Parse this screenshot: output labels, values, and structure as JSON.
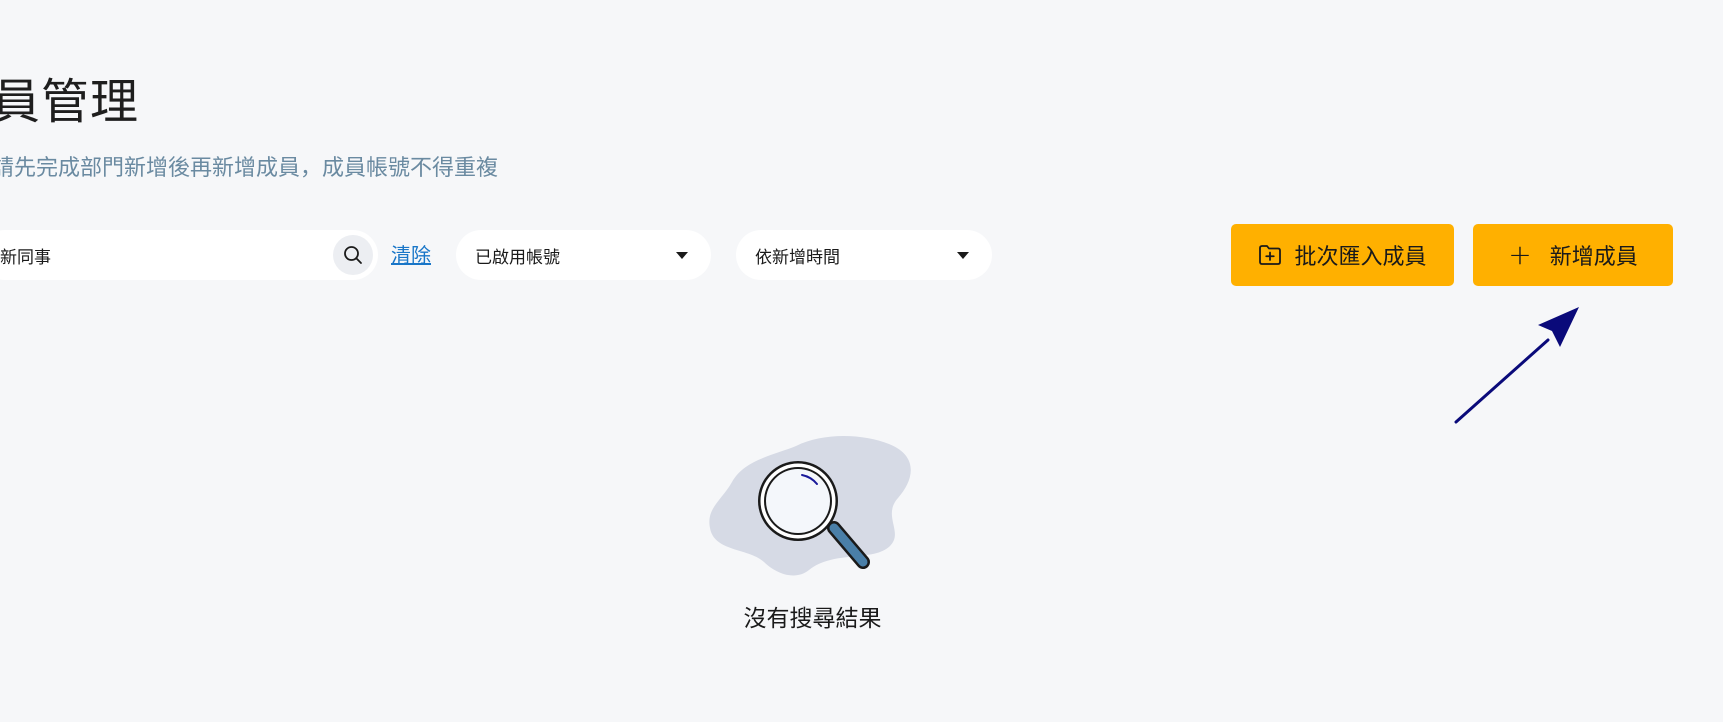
{
  "header": {
    "title": "員管理",
    "subtitle": "請先完成部門新增後再新增成員，成員帳號不得重複"
  },
  "toolbar": {
    "search": {
      "value": "新同事",
      "icon": "search-icon"
    },
    "clear_label": "清除",
    "status_filter": {
      "selected": "已啟用帳號"
    },
    "sort_filter": {
      "selected": "依新增時間"
    },
    "import_button": {
      "label": "批次匯入成員",
      "icon": "folder-plus-icon"
    },
    "add_button": {
      "label": "新增成員",
      "icon": "plus-icon"
    }
  },
  "empty_state": {
    "message": "沒有搜尋結果",
    "icon": "magnifier-illustration"
  },
  "colors": {
    "accent": "#ffb000",
    "link": "#1976c8",
    "subtitle": "#6a8aa1",
    "annotation": "#0a0a7a"
  }
}
